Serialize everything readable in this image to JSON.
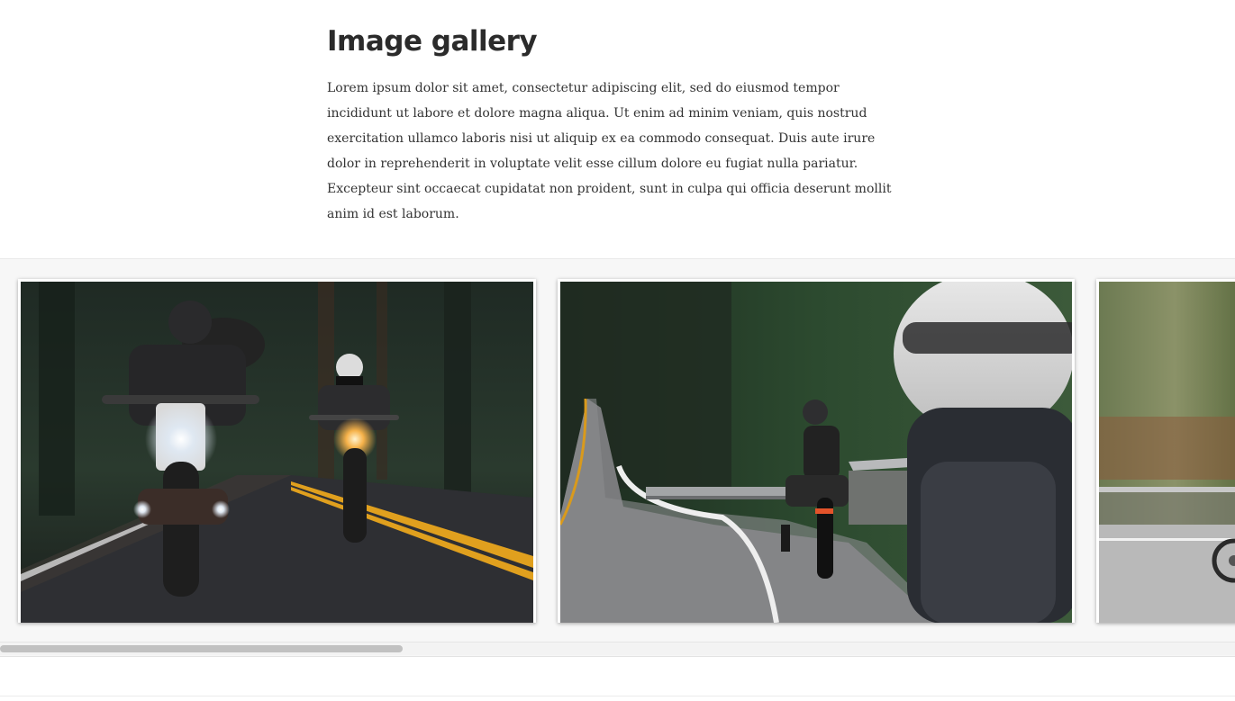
{
  "page": {
    "title": "Image gallery",
    "body": "Lorem ipsum dolor sit amet, consectetur adipiscing elit, sed do eiusmod tempor incididunt ut labore et dolore magna aliqua. Ut enim ad minim veniam, quis nostrud exercitation ullamco laboris nisi ut aliquip ex ea commodo consequat. Duis aute irure dolor in reprehenderit in voluptate velit esse cillum dolore eu fugiat nulla pariatur. Excepteur sint occaecat cupidatat non proident, sunt in culpa qui officia deserunt mollit anim id est laborum."
  },
  "gallery": {
    "images": [
      {
        "subject": "two motorcyclists riding toward camera on forest road at dusk"
      },
      {
        "subject": "motorcyclist stopped at roadside guardrail on winding forest road"
      },
      {
        "subject": "motorcyclist in motion blur on road"
      }
    ],
    "scroll_position": 0
  },
  "colors": {
    "heading": "#2b2b2b",
    "text": "#333333",
    "band_background": "#f7f7f7",
    "scroll_thumb": "#c1c1c1"
  }
}
